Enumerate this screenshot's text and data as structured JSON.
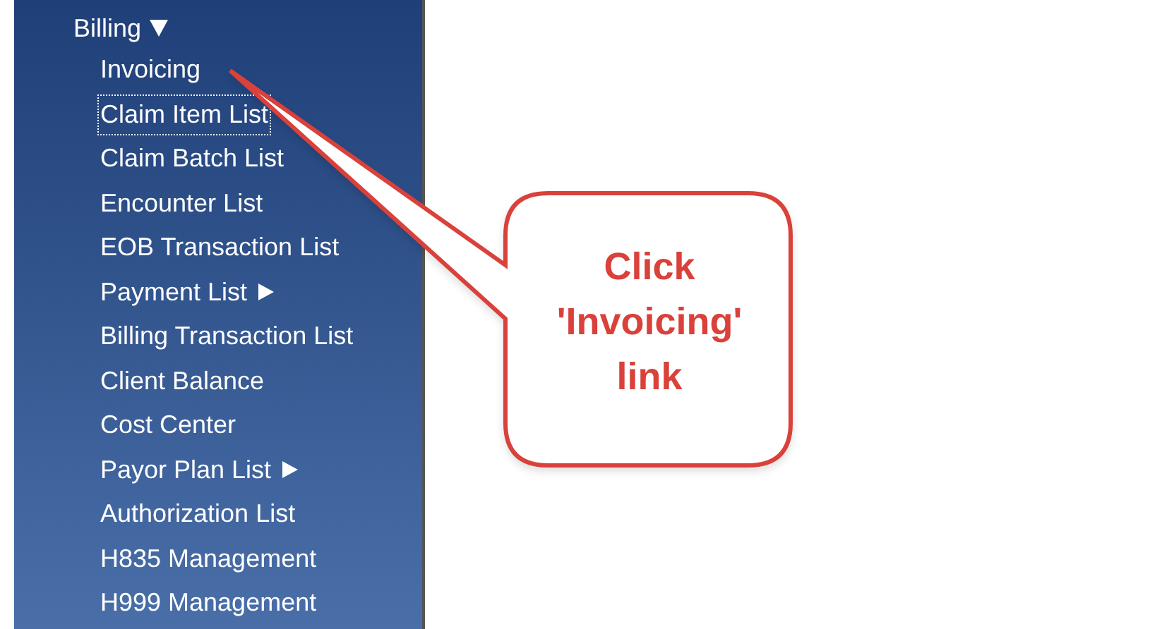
{
  "menu": {
    "header": {
      "label": "Billing",
      "expanded": true
    },
    "items": [
      {
        "label": "Invoicing",
        "focused": false,
        "submenu": false
      },
      {
        "label": "Claim Item List",
        "focused": true,
        "submenu": false
      },
      {
        "label": "Claim Batch List",
        "focused": false,
        "submenu": false
      },
      {
        "label": "Encounter List",
        "focused": false,
        "submenu": false
      },
      {
        "label": "EOB Transaction List",
        "focused": false,
        "submenu": false
      },
      {
        "label": "Payment List",
        "focused": false,
        "submenu": true
      },
      {
        "label": "Billing Transaction List",
        "focused": false,
        "submenu": false
      },
      {
        "label": "Client Balance",
        "focused": false,
        "submenu": false
      },
      {
        "label": "Cost Center",
        "focused": false,
        "submenu": false
      },
      {
        "label": "Payor Plan List",
        "focused": false,
        "submenu": true
      },
      {
        "label": "Authorization List",
        "focused": false,
        "submenu": false
      },
      {
        "label": "H835 Management",
        "focused": false,
        "submenu": false
      },
      {
        "label": "H999 Management",
        "focused": false,
        "submenu": false
      }
    ]
  },
  "callout": {
    "text": "Click 'Invoicing' link"
  }
}
